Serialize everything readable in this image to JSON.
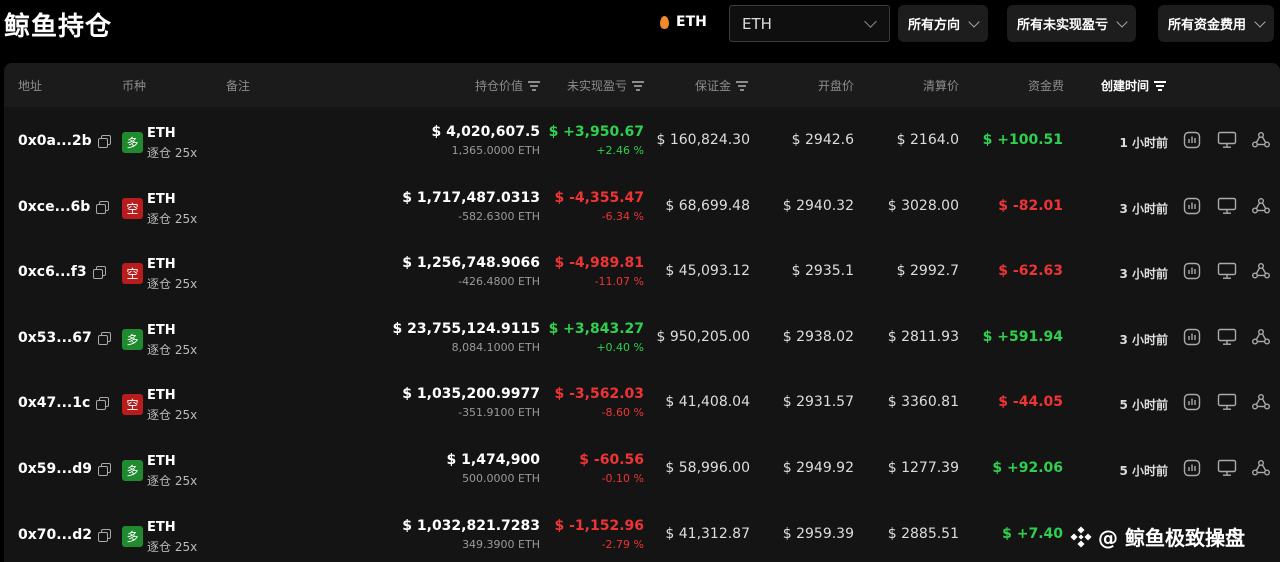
{
  "header": {
    "title": "鲸鱼持仓",
    "coin_label": "ETH",
    "coin_select_value": "ETH",
    "filters": [
      "所有方向",
      "所有未实现盈亏",
      "所有资金费用"
    ]
  },
  "table": {
    "columns": {
      "address": "地址",
      "coin": "币种",
      "note": "备注",
      "position_value": "持仓价值",
      "unrealized_pnl": "未实现盈亏",
      "margin": "保证金",
      "entry_price": "开盘价",
      "liq_price": "清算价",
      "funding": "资金费",
      "created": "创建时间"
    },
    "rows": [
      {
        "address": "0x0a...2b",
        "side": "多",
        "side_type": "long",
        "coin": "ETH",
        "leverage": "逐仓 25x",
        "value": "$ 4,020,607.5",
        "size": "1,365.0000 ETH",
        "pnl": "$ +3,950.67",
        "pnl_pct": "+2.46 %",
        "pnl_color": "green",
        "margin": "$ 160,824.30",
        "entry": "$ 2942.6",
        "liq": "$ 2164.0",
        "funding": "$ +100.51",
        "funding_color": "green",
        "time": "1 小时前"
      },
      {
        "address": "0xce...6b",
        "side": "空",
        "side_type": "short",
        "coin": "ETH",
        "leverage": "逐仓 25x",
        "value": "$ 1,717,487.0313",
        "size": "-582.6300 ETH",
        "pnl": "$ -4,355.47",
        "pnl_pct": "-6.34 %",
        "pnl_color": "red",
        "margin": "$ 68,699.48",
        "entry": "$ 2940.32",
        "liq": "$ 3028.00",
        "funding": "$ -82.01",
        "funding_color": "red",
        "time": "3 小时前"
      },
      {
        "address": "0xc6...f3",
        "side": "空",
        "side_type": "short",
        "coin": "ETH",
        "leverage": "逐仓 25x",
        "value": "$ 1,256,748.9066",
        "size": "-426.4800 ETH",
        "pnl": "$ -4,989.81",
        "pnl_pct": "-11.07 %",
        "pnl_color": "red",
        "margin": "$ 45,093.12",
        "entry": "$ 2935.1",
        "liq": "$ 2992.7",
        "funding": "$ -62.63",
        "funding_color": "red",
        "time": "3 小时前"
      },
      {
        "address": "0x53...67",
        "side": "多",
        "side_type": "long",
        "coin": "ETH",
        "leverage": "逐仓 25x",
        "value": "$ 23,755,124.9115",
        "size": "8,084.1000 ETH",
        "pnl": "$ +3,843.27",
        "pnl_pct": "+0.40 %",
        "pnl_color": "green",
        "margin": "$ 950,205.00",
        "entry": "$ 2938.02",
        "liq": "$ 2811.93",
        "funding": "$ +591.94",
        "funding_color": "green",
        "time": "3 小时前"
      },
      {
        "address": "0x47...1c",
        "side": "空",
        "side_type": "short",
        "coin": "ETH",
        "leverage": "逐仓 25x",
        "value": "$ 1,035,200.9977",
        "size": "-351.9100 ETH",
        "pnl": "$ -3,562.03",
        "pnl_pct": "-8.60 %",
        "pnl_color": "red",
        "margin": "$ 41,408.04",
        "entry": "$ 2931.57",
        "liq": "$ 3360.81",
        "funding": "$ -44.05",
        "funding_color": "red",
        "time": "5 小时前"
      },
      {
        "address": "0x59...d9",
        "side": "多",
        "side_type": "long",
        "coin": "ETH",
        "leverage": "逐仓 25x",
        "value": "$ 1,474,900",
        "size": "500.0000 ETH",
        "pnl": "$ -60.56",
        "pnl_pct": "-0.10 %",
        "pnl_color": "red",
        "margin": "$ 58,996.00",
        "entry": "$ 2949.92",
        "liq": "$ 1277.39",
        "funding": "$ +92.06",
        "funding_color": "green",
        "time": "5 小时前"
      },
      {
        "address": "0x70...d2",
        "side": "多",
        "side_type": "long",
        "coin": "ETH",
        "leverage": "逐仓 25x",
        "value": "$ 1,032,821.7283",
        "size": "349.3900 ETH",
        "pnl": "$ -1,152.96",
        "pnl_pct": "-2.79 %",
        "pnl_color": "red",
        "margin": "$ 41,312.87",
        "entry": "$ 2959.39",
        "liq": "$ 2885.51",
        "funding": "$ +7.40",
        "funding_color": "green",
        "time": ""
      }
    ],
    "row_actions": [
      "chart-icon",
      "monitor-icon",
      "share-icon"
    ]
  },
  "watermark": {
    "text": "@ 鲸鱼极致操盘",
    "logo": "binance-square-logo"
  },
  "colors": {
    "positive": "#2fd04e",
    "negative": "#ee3434",
    "long_badge": "#1f8a2e",
    "short_badge": "#b81c1c",
    "coin_accent": "#f08a2c"
  }
}
